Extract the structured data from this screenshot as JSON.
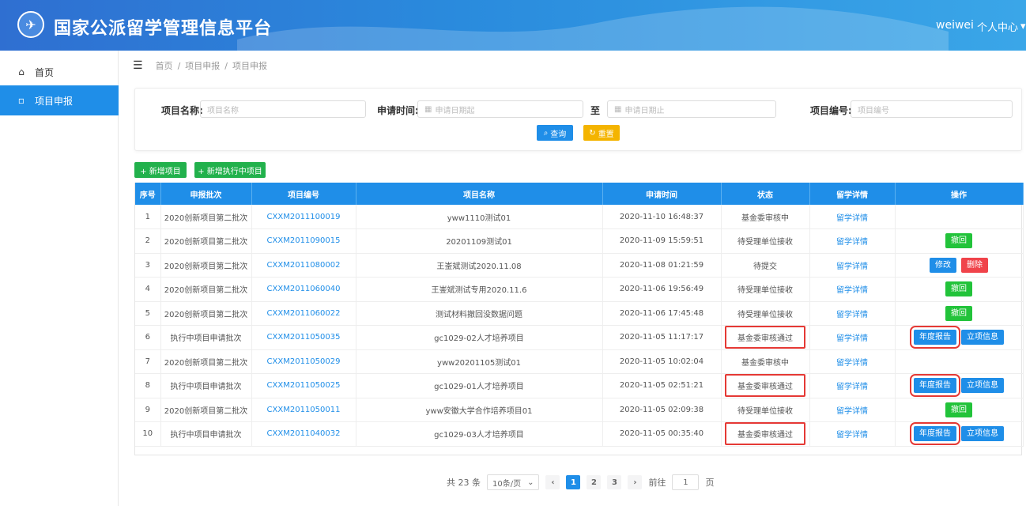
{
  "header": {
    "logo_glyph": "✈",
    "title": "国家公派留学管理信息平台",
    "user": "weiwei",
    "user_center": "个人中心"
  },
  "sidebar": {
    "items": [
      {
        "label": "首页",
        "icon": "home-icon"
      },
      {
        "label": "项目申报",
        "icon": "folder-icon"
      }
    ]
  },
  "breadcrumb": [
    "首页",
    "/",
    "项目申报",
    "/",
    "项目申报"
  ],
  "search": {
    "name_label": "项目名称:",
    "name_placeholder": "项目名称",
    "time_label": "申请时间:",
    "start_placeholder": "申请日期起",
    "to": "至",
    "end_placeholder": "申请日期止",
    "code_label": "项目编号:",
    "code_placeholder": "项目编号",
    "query": "查询",
    "reset": "重置"
  },
  "actions": {
    "add_project": "+ 新增项目",
    "add_exec_project": "+ 新增执行中项目"
  },
  "table": {
    "headers": [
      "序号",
      "申报批次",
      "项目编号",
      "项目名称",
      "申请时间",
      "状态",
      "留学详情",
      "操作"
    ],
    "rows": [
      {
        "no": "1",
        "batch": "2020创新项目第二批次",
        "code": "CXXM2011100019",
        "name": "yww1110测试01",
        "time": "2020-11-10 16:48:37",
        "status": "基金委审核中",
        "detail": "留学详情",
        "ops": []
      },
      {
        "no": "2",
        "batch": "2020创新项目第二批次",
        "code": "CXXM2011090015",
        "name": "20201109测试01",
        "time": "2020-11-09 15:59:51",
        "status": "待受理单位接收",
        "detail": "留学详情",
        "ops": [
          "撤回"
        ]
      },
      {
        "no": "3",
        "batch": "2020创新项目第二批次",
        "code": "CXXM2011080002",
        "name": "王崟斌测试2020.11.08",
        "time": "2020-11-08 01:21:59",
        "status": "待提交",
        "detail": "留学详情",
        "ops": [
          "修改",
          "删除"
        ]
      },
      {
        "no": "4",
        "batch": "2020创新项目第二批次",
        "code": "CXXM2011060040",
        "name": "王崟斌测试专用2020.11.6",
        "time": "2020-11-06 19:56:49",
        "status": "待受理单位接收",
        "detail": "留学详情",
        "ops": [
          "撤回"
        ]
      },
      {
        "no": "5",
        "batch": "2020创新项目第二批次",
        "code": "CXXM2011060022",
        "name": "测试材料撤回没数据问题",
        "time": "2020-11-06 17:45:48",
        "status": "待受理单位接收",
        "detail": "留学详情",
        "ops": [
          "撤回"
        ]
      },
      {
        "no": "6",
        "batch": "执行中项目申请批次",
        "code": "CXXM2011050035",
        "name": "gc1029-02人才培养项目",
        "time": "2020-11-05 11:17:17",
        "status": "基金委审核通过",
        "detail": "留学详情",
        "ops": [
          "年度报告",
          "立项信息"
        ]
      },
      {
        "no": "7",
        "batch": "2020创新项目第二批次",
        "code": "CXXM2011050029",
        "name": "yww20201105测试01",
        "time": "2020-11-05 10:02:04",
        "status": "基金委审核中",
        "detail": "留学详情",
        "ops": []
      },
      {
        "no": "8",
        "batch": "执行中项目申请批次",
        "code": "CXXM2011050025",
        "name": "gc1029-01人才培养项目",
        "time": "2020-11-05 02:51:21",
        "status": "基金委审核通过",
        "detail": "留学详情",
        "ops": [
          "年度报告",
          "立项信息"
        ]
      },
      {
        "no": "9",
        "batch": "2020创新项目第二批次",
        "code": "CXXM2011050011",
        "name": "yww安徽大学合作培养项目01",
        "time": "2020-11-05 02:09:38",
        "status": "待受理单位接收",
        "detail": "留学详情",
        "ops": [
          "撤回"
        ]
      },
      {
        "no": "10",
        "batch": "执行中项目申请批次",
        "code": "CXXM2011040032",
        "name": "gc1029-03人才培养项目",
        "time": "2020-11-05 00:35:40",
        "status": "基金委审核通过",
        "detail": "留学详情",
        "ops": [
          "年度报告",
          "立项信息"
        ]
      }
    ]
  },
  "pager": {
    "total": "共 23 条",
    "page_size": "10条/页",
    "pages": [
      "1",
      "2",
      "3"
    ],
    "current": "1",
    "goto_label": "前往",
    "goto_value": "1",
    "page_unit": "页"
  },
  "colors": {
    "header": "#2a8bdd",
    "primary": "#1f8ee8",
    "success": "#22c33a",
    "warning": "#f4b400",
    "danger": "#f0434a",
    "highlight": "#e53935"
  }
}
